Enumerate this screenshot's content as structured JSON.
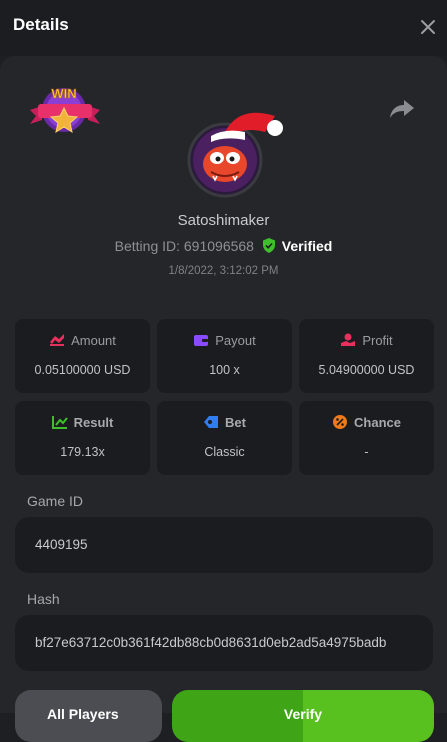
{
  "header": {
    "title": "Details"
  },
  "user": {
    "name": "Satoshimaker",
    "betting_id": "Betting ID: 691096568",
    "verified_label": "Verified",
    "date": "1/8/2022, 3:12:02 PM"
  },
  "win_badge": {
    "text": "WIN"
  },
  "stats": [
    {
      "label": "Amount",
      "value": "0.05100000 USD",
      "icon": "amount-icon"
    },
    {
      "label": "Payout",
      "value": "100 x",
      "icon": "wallet-icon"
    },
    {
      "label": "Profit",
      "value": "5.04900000 USD",
      "icon": "profit-icon"
    },
    {
      "label": "Result",
      "value": "179.13x",
      "icon": "chart-icon"
    },
    {
      "label": "Bet",
      "value": "Classic",
      "icon": "tag-icon"
    },
    {
      "label": "Chance",
      "value": "-",
      "icon": "percent-icon"
    }
  ],
  "game": {
    "label": "Game ID",
    "value": "4409195"
  },
  "hash": {
    "label": "Hash",
    "value": "bf27e63712c0b361f42db88cb0d8631d0eb2ad5a4975badb"
  },
  "buttons": {
    "all_players": "All Players",
    "verify": "Verify"
  },
  "colors": {
    "verified": "#3fbf2b",
    "verify_button": "#58c11f"
  }
}
